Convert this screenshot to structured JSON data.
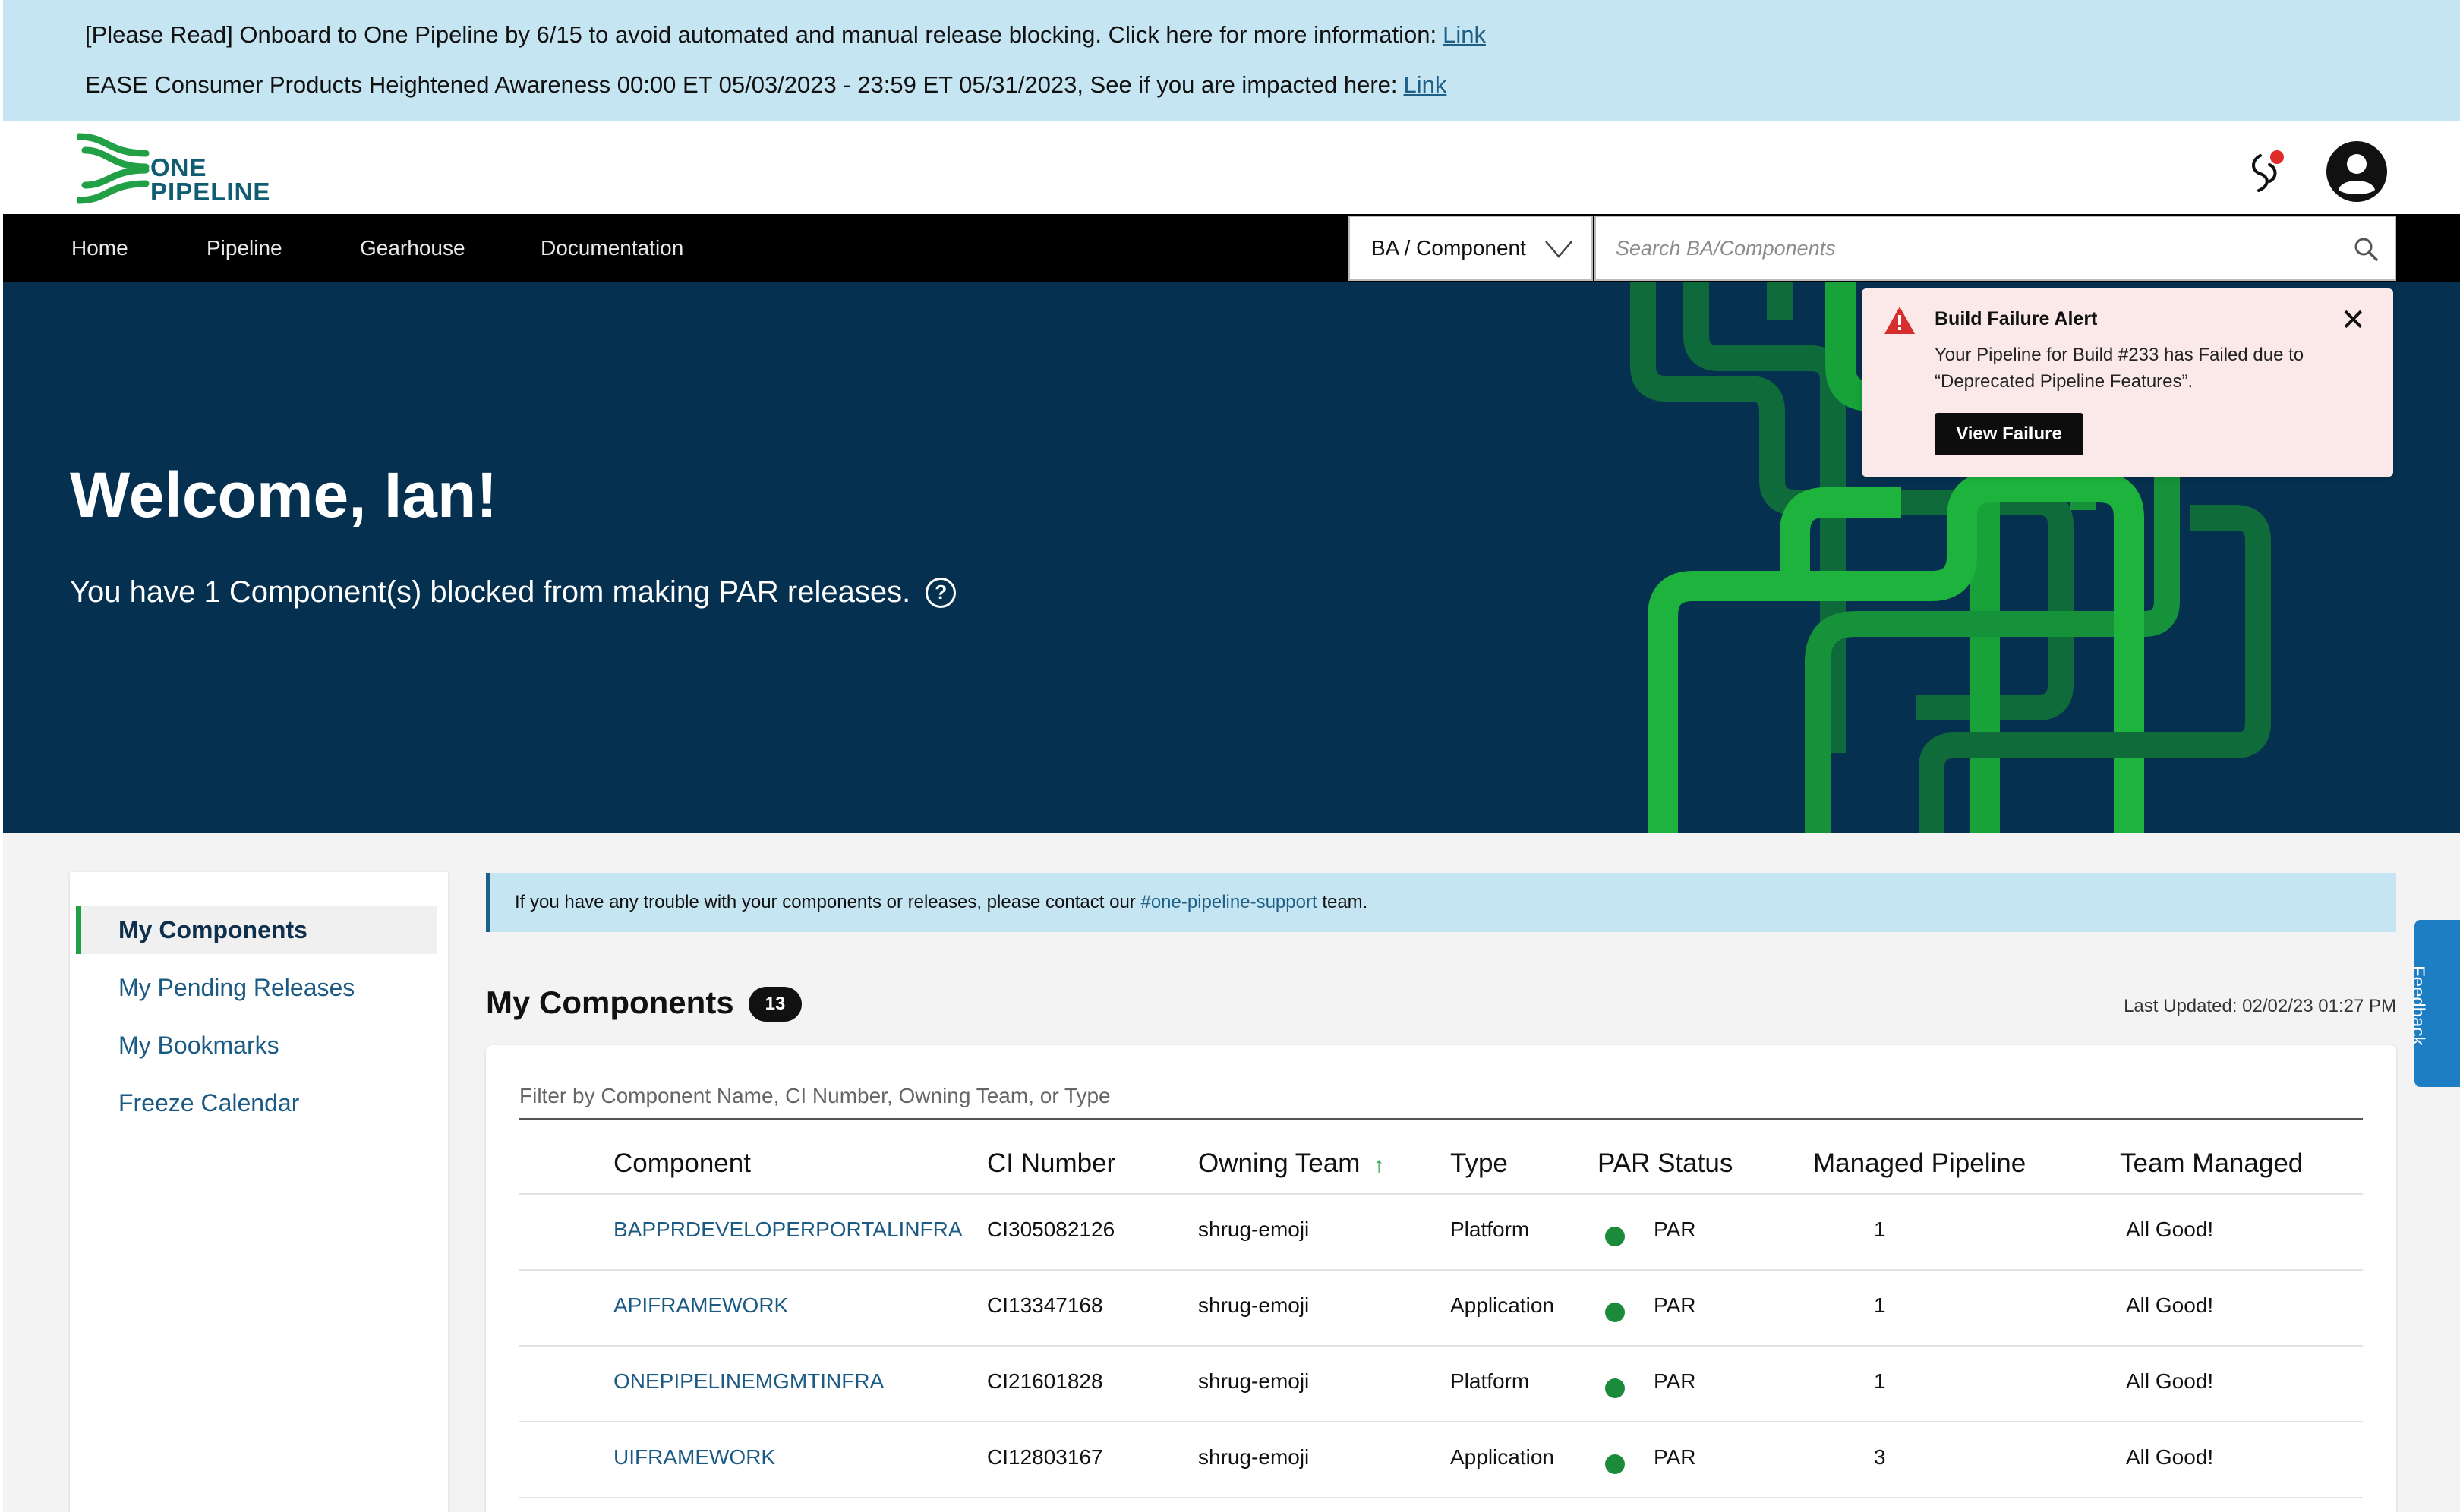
{
  "announcements": [
    {
      "text": "[Please Read] Onboard to One Pipeline by 6/15 to avoid automated and manual release blocking. Click here for more information:",
      "link": "Link"
    },
    {
      "text": "EASE Consumer Products Heightened Awareness 00:00 ET 05/03/2023 - 23:59 ET 05/31/2023, See if you are impacted here:",
      "link": "Link"
    }
  ],
  "brand": {
    "line1": "ONE",
    "line2": "PIPELINE",
    "accent": "#22a045",
    "primary": "#0f5c73"
  },
  "nav": {
    "items": [
      "Home",
      "Pipeline",
      "Gearhouse",
      "Documentation"
    ],
    "dropdown": "BA / Component",
    "search_placeholder": "Search BA/Components"
  },
  "hero": {
    "title": "Welcome, Ian!",
    "subtitle": "You have 1 Component(s) blocked from making PAR releases.",
    "help_icon": "?"
  },
  "alert": {
    "title": "Build Failure Alert",
    "message": "Your Pipeline for Build #233 has Failed due to “Deprecated Pipeline Features”.",
    "button": "View Failure",
    "close": "✕"
  },
  "sidebar": {
    "items": [
      "My Components",
      "My Pending Releases",
      "My Bookmarks",
      "Freeze Calendar"
    ],
    "active": "My Components"
  },
  "info": {
    "before": "If you have any trouble with your components or releases, please contact our",
    "link": "#one-pipeline-support",
    "after": "team."
  },
  "components": {
    "title": "My Components",
    "count": "13",
    "last_updated": "Last Updated: 02/02/23 01:27 PM",
    "filter_placeholder": "Filter by Component Name, CI Number, Owning Team, or Type",
    "columns": [
      "Component",
      "CI Number",
      "Owning Team",
      "Type",
      "PAR Status",
      "Managed Pipeline",
      "Team Managed"
    ],
    "sort_indicator": "↑",
    "rows": [
      {
        "component": "BAPPRDEVELOPERPORTALINFRA",
        "ci": "CI305082126",
        "team": "shrug-emoji",
        "type": "Platform",
        "par": "PAR",
        "managed": "1",
        "team_managed": "All Good!"
      },
      {
        "component": "APIFRAMEWORK",
        "ci": "CI13347168",
        "team": "shrug-emoji",
        "type": "Application",
        "par": "PAR",
        "managed": "1",
        "team_managed": "All Good!"
      },
      {
        "component": "ONEPIPELINEMGMTINFRA",
        "ci": "CI21601828",
        "team": "shrug-emoji",
        "type": "Platform",
        "par": "PAR",
        "managed": "1",
        "team_managed": "All Good!"
      },
      {
        "component": "UIFRAMEWORK",
        "ci": "CI12803167",
        "team": "shrug-emoji",
        "type": "Application",
        "par": "PAR",
        "managed": "3",
        "team_managed": "All Good!"
      }
    ],
    "status_color": "#1c8a3b"
  },
  "feedback": "Feedback"
}
